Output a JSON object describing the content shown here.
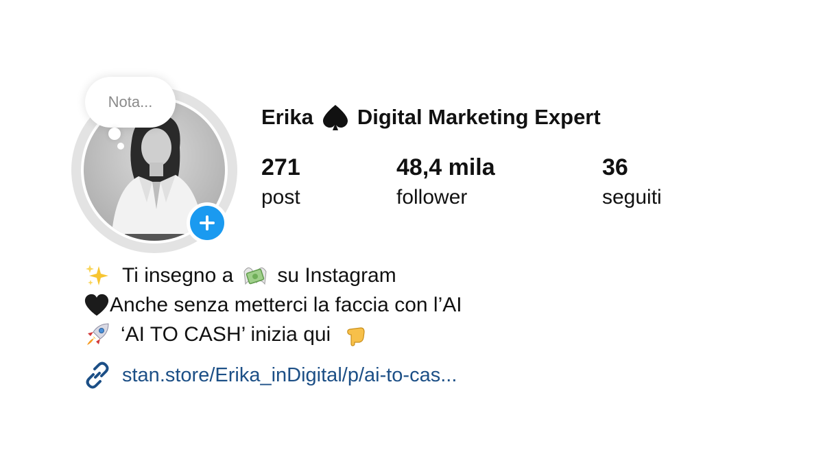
{
  "profile": {
    "name_first": "Erika",
    "name_rest": "Digital Marketing Expert",
    "name_icon": "spade-icon"
  },
  "note": {
    "placeholder": "Nota..."
  },
  "stats": [
    {
      "value": "271",
      "label": "post"
    },
    {
      "value": "48,4 mila",
      "label": "follower"
    },
    {
      "value": "36",
      "label": "seguiti"
    }
  ],
  "bio": {
    "line1_a": "Ti insegno a",
    "line1_b": "su Instagram",
    "line2": "Anche senza metterci la faccia con l’AI",
    "line3": "‘AI TO CASH’ inizia qui"
  },
  "link": {
    "text": "stan.store/Erika_inDigital/p/ai-to-cas...",
    "color": "#1c4f86",
    "icon": "link-icon"
  },
  "colors": {
    "add_button": "#1a9af0",
    "ring": "#e3e3e3"
  }
}
